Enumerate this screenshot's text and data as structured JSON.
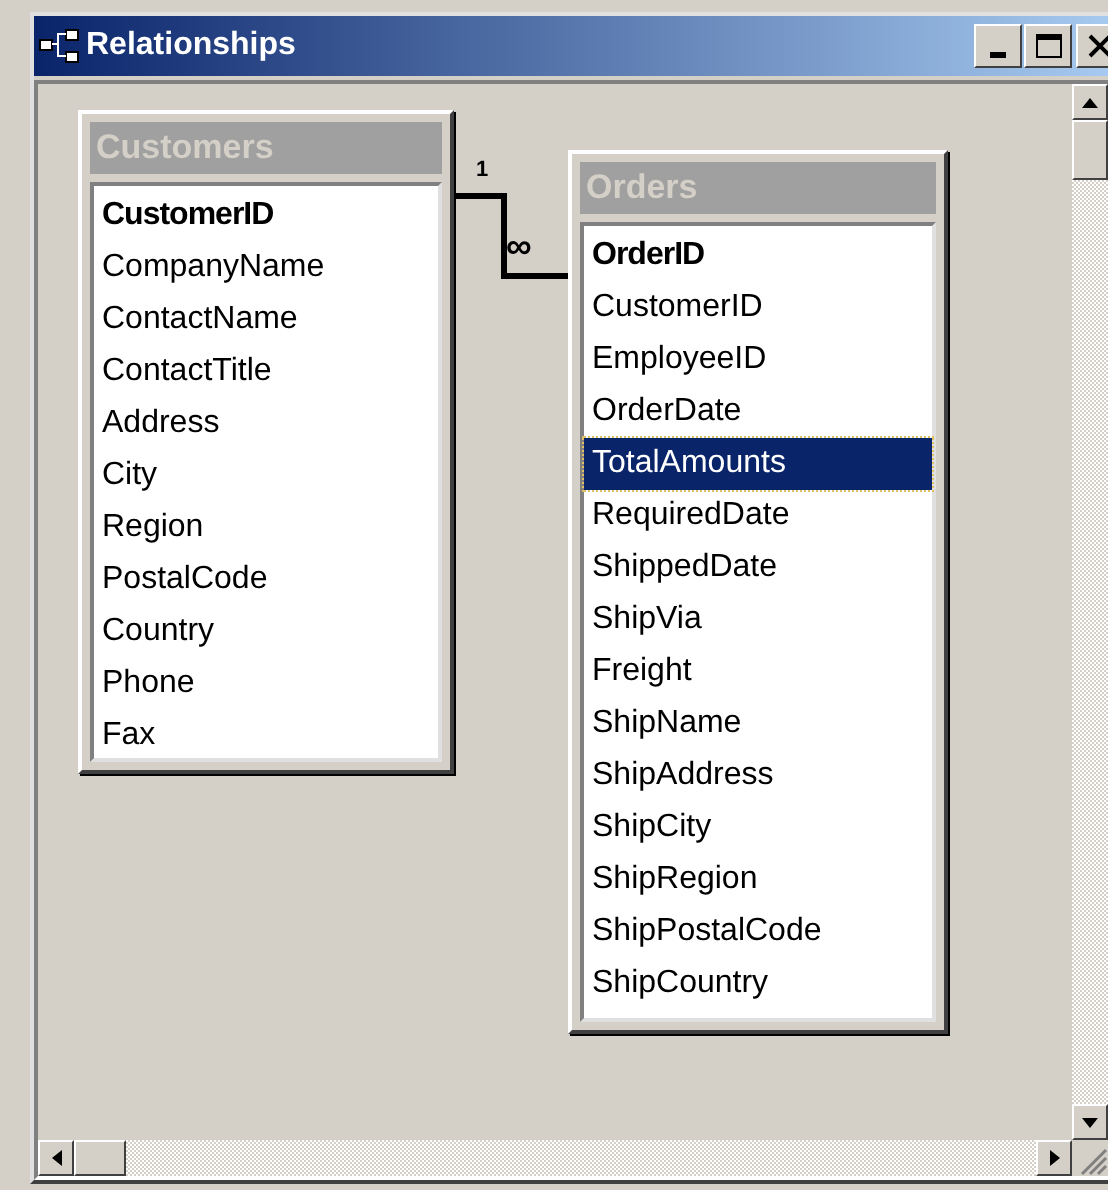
{
  "window": {
    "title": "Relationships"
  },
  "tables": [
    {
      "name": "Customers",
      "fields": [
        {
          "name": "CustomerID",
          "key": true,
          "selected": false
        },
        {
          "name": "CompanyName",
          "key": false,
          "selected": false
        },
        {
          "name": "ContactName",
          "key": false,
          "selected": false
        },
        {
          "name": "ContactTitle",
          "key": false,
          "selected": false
        },
        {
          "name": "Address",
          "key": false,
          "selected": false
        },
        {
          "name": "City",
          "key": false,
          "selected": false
        },
        {
          "name": "Region",
          "key": false,
          "selected": false
        },
        {
          "name": "PostalCode",
          "key": false,
          "selected": false
        },
        {
          "name": "Country",
          "key": false,
          "selected": false
        },
        {
          "name": "Phone",
          "key": false,
          "selected": false
        },
        {
          "name": "Fax",
          "key": false,
          "selected": false
        }
      ]
    },
    {
      "name": "Orders",
      "fields": [
        {
          "name": "OrderID",
          "key": true,
          "selected": false
        },
        {
          "name": "CustomerID",
          "key": false,
          "selected": false
        },
        {
          "name": "EmployeeID",
          "key": false,
          "selected": false
        },
        {
          "name": "OrderDate",
          "key": false,
          "selected": false
        },
        {
          "name": "TotalAmounts",
          "key": false,
          "selected": true
        },
        {
          "name": "RequiredDate",
          "key": false,
          "selected": false
        },
        {
          "name": "ShippedDate",
          "key": false,
          "selected": false
        },
        {
          "name": "ShipVia",
          "key": false,
          "selected": false
        },
        {
          "name": "Freight",
          "key": false,
          "selected": false
        },
        {
          "name": "ShipName",
          "key": false,
          "selected": false
        },
        {
          "name": "ShipAddress",
          "key": false,
          "selected": false
        },
        {
          "name": "ShipCity",
          "key": false,
          "selected": false
        },
        {
          "name": "ShipRegion",
          "key": false,
          "selected": false
        },
        {
          "name": "ShipPostalCode",
          "key": false,
          "selected": false
        },
        {
          "name": "ShipCountry",
          "key": false,
          "selected": false
        }
      ]
    }
  ],
  "relationship": {
    "one_label": "1",
    "many_label": "∞"
  }
}
